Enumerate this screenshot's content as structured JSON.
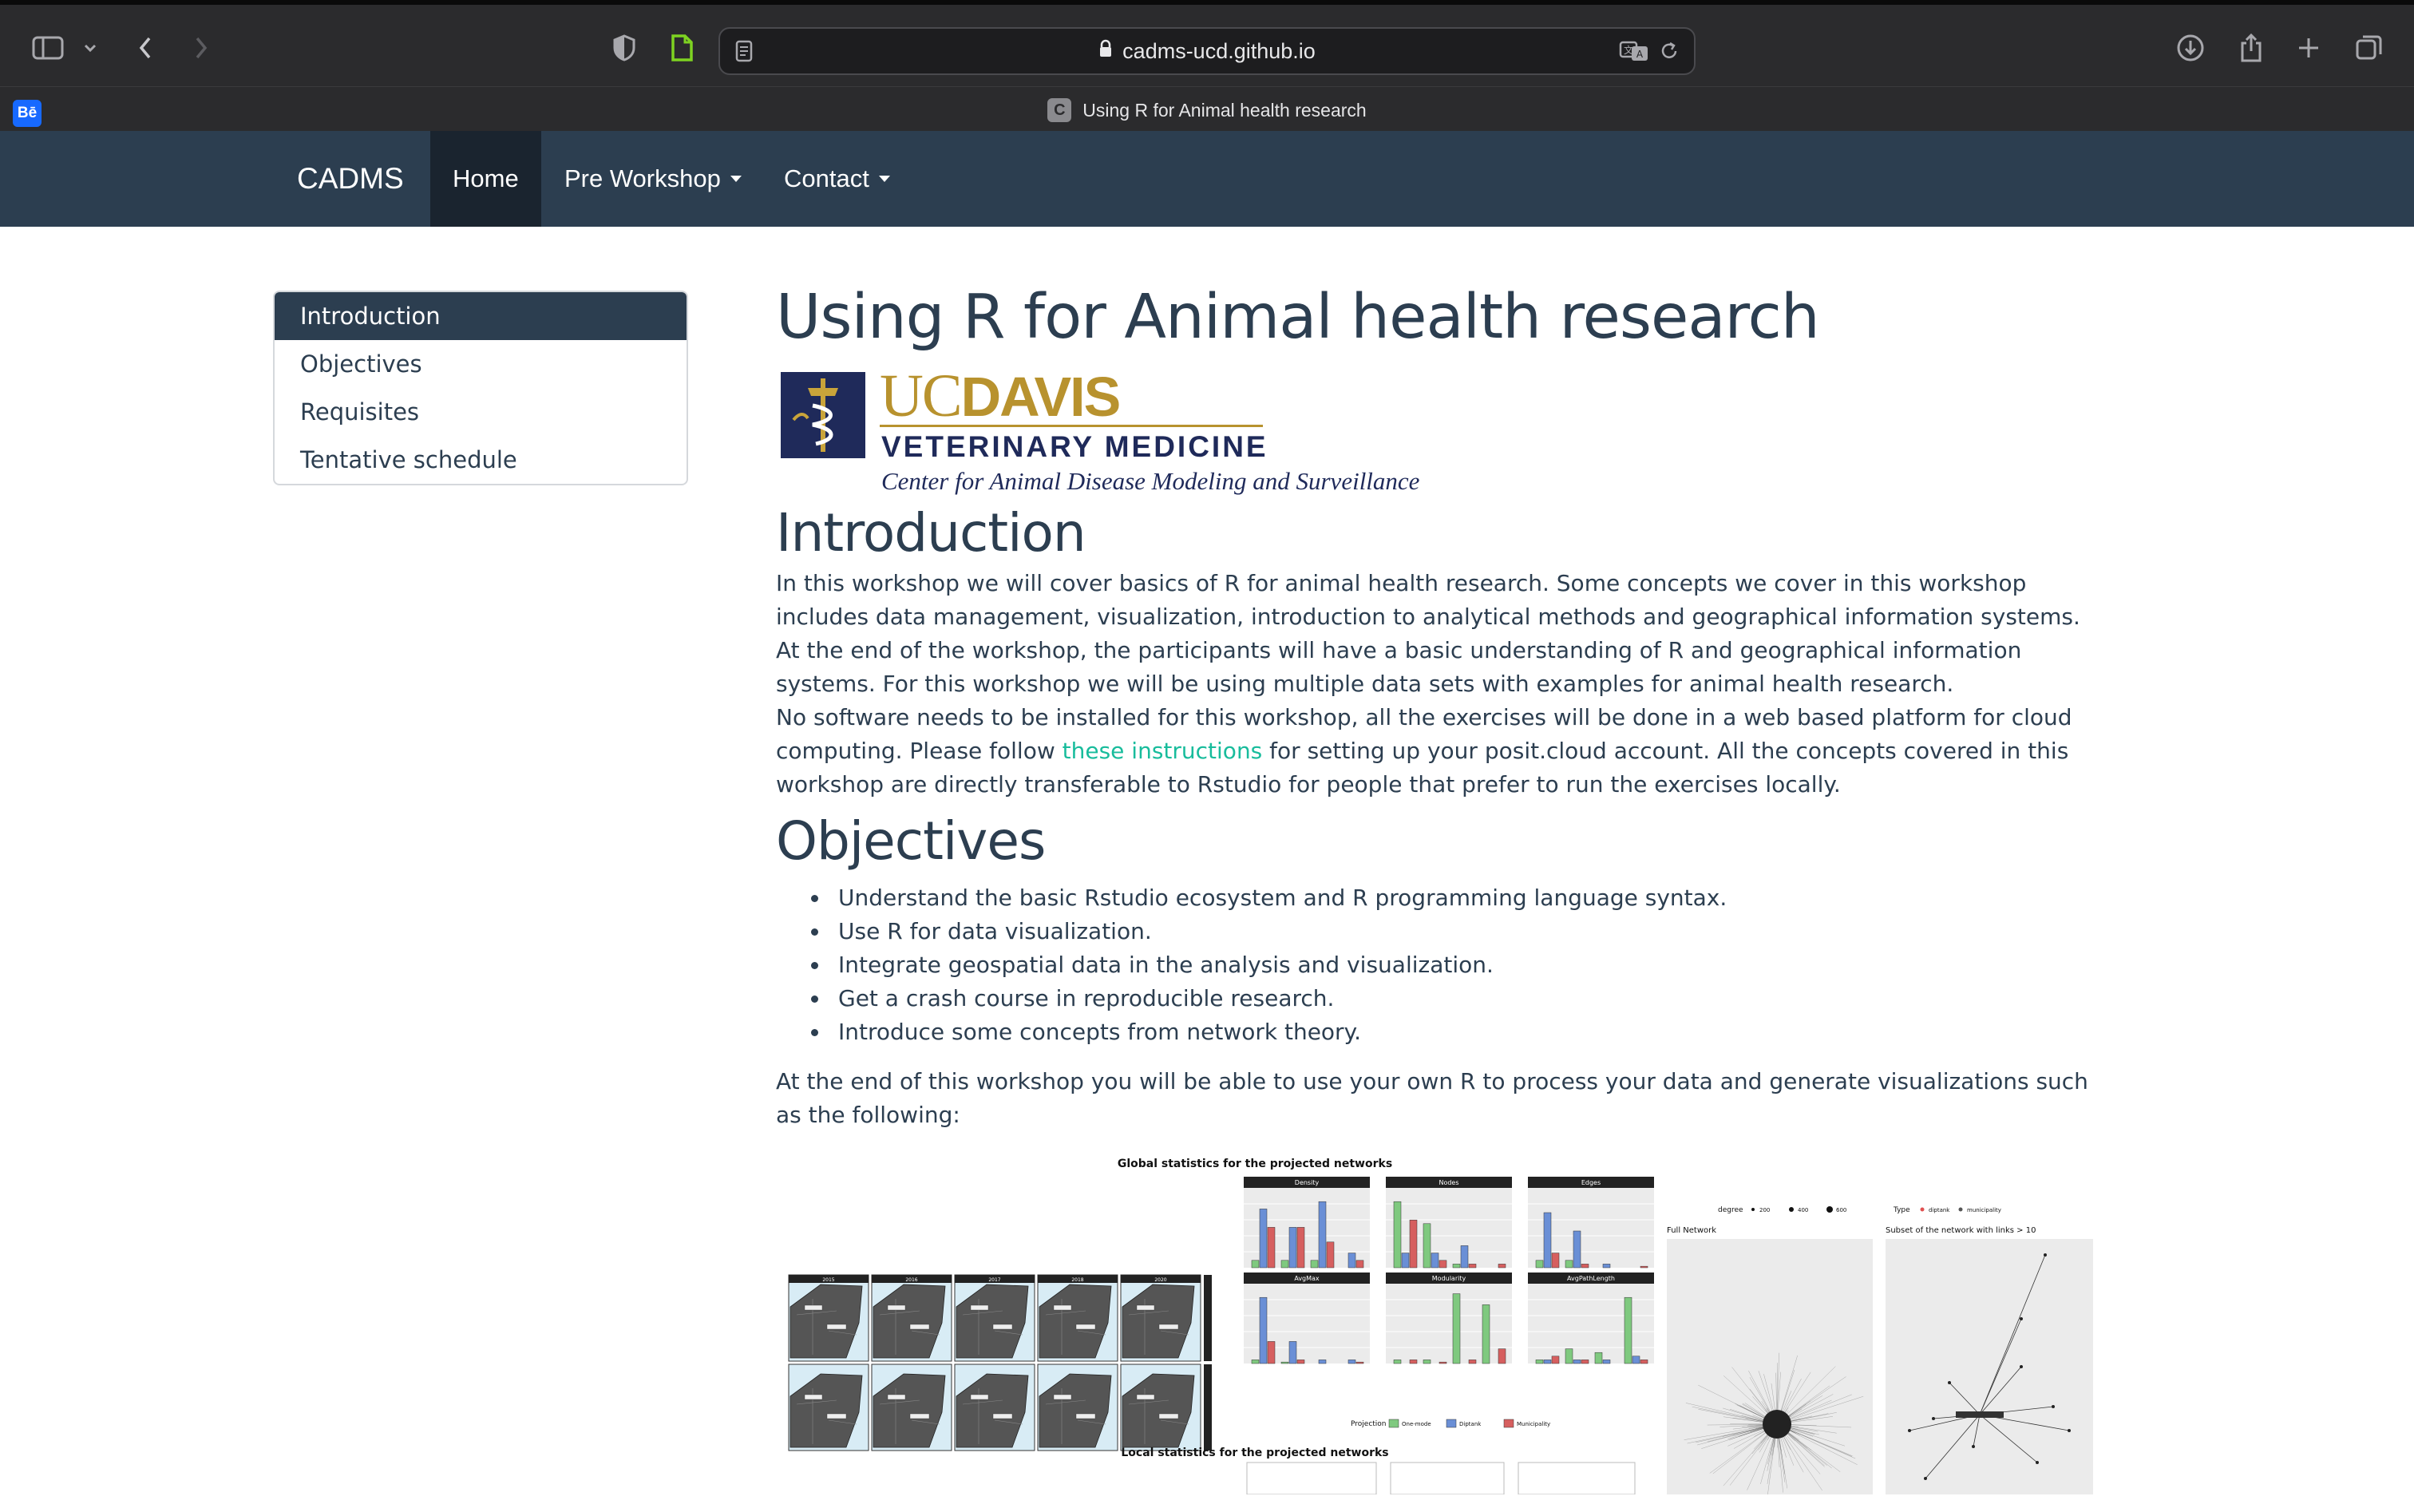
{
  "browser": {
    "url": "cadms-ucd.github.io",
    "tab_title": "Using R for Animal health research",
    "tab_favicon_letter": "C",
    "pinned_favicon": "Bē"
  },
  "navbar": {
    "brand": "CADMS",
    "items": [
      {
        "label": "Home",
        "active": true,
        "dropdown": false
      },
      {
        "label": "Pre Workshop",
        "active": false,
        "dropdown": true
      },
      {
        "label": "Contact",
        "active": false,
        "dropdown": true
      }
    ]
  },
  "toc": {
    "items": [
      "Introduction",
      "Objectives",
      "Requisites",
      "Tentative schedule"
    ],
    "active": "Introduction"
  },
  "content": {
    "title": "Using R for Animal health research",
    "logo": {
      "uc": "UC",
      "davis": "DAVIS",
      "vetmed": "VETERINARY MEDICINE",
      "center": "Center for Animal Disease Modeling and Surveillance"
    },
    "intro_heading": "Introduction",
    "intro_p1": "In this workshop we will cover basics of R for animal health research. Some concepts we cover in this workshop includes data management, visualization, introduction to analytical methods and geographical information systems. At the end of the workshop, the participants will have a basic understanding of R and geographical information systems. For this workshop we will be using multiple data sets with examples for animal health research.",
    "intro_p2_before": "No software needs to be installed for this workshop, all the exercises will be done in a web based platform for cloud computing. Please follow ",
    "intro_p2_link": "these instructions",
    "intro_p2_after": " for setting up your posit.cloud account. All the concepts covered in this workshop are directly transferable to Rstudio for people that prefer to run the exercises locally.",
    "objectives_heading": "Objectives",
    "objectives": [
      "Understand the basic Rstudio ecosystem and R programming language syntax.",
      "Use R for data visualization.",
      "Integrate geospatial data in the analysis and visualization.",
      "Get a crash course in reproducible research.",
      "Introduce some concepts from network theory."
    ],
    "closing": "At the end of this workshop you will be able to use your own R to process your data and generate visualizations such as the following:"
  },
  "figure": {
    "title": "Global statistics for the projected networks",
    "subtitle2": "Local statistics for the projected networks",
    "map_years": [
      "2015",
      "2016",
      "2017",
      "2018",
      "2020"
    ],
    "panels": [
      "Density",
      "Nodes",
      "Edges",
      "AvgMax",
      "Modularity",
      "AvgPathLength"
    ],
    "legend_projection": "Projection",
    "legend_items": [
      "One-mode",
      "Diptank",
      "Municipality"
    ],
    "network_legend_degree": "degree",
    "network_degree_values": [
      "200",
      "400",
      "600"
    ],
    "network_legend_type": "Type",
    "network_type_values": [
      "diptank",
      "municipality"
    ],
    "network_left_title": "Full Network",
    "network_right_title": "Subset of the network with links > 10",
    "colors": {
      "one_mode": "#7fc97f",
      "diptank": "#6a8fd6",
      "municipality": "#d65f5f"
    }
  }
}
